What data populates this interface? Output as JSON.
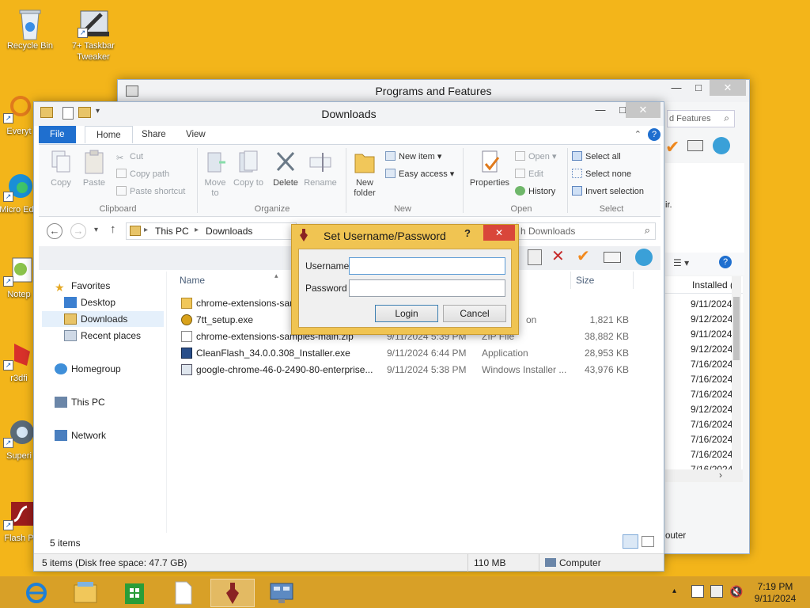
{
  "desktop": {
    "icons": [
      {
        "label": "Recycle Bin"
      },
      {
        "label": "7+ Taskbar Tweaker"
      },
      {
        "label": "Everyt"
      },
      {
        "label": "Micro Edg"
      },
      {
        "label": "Notep"
      },
      {
        "label": "r3dfi"
      },
      {
        "label": "Superi"
      },
      {
        "label": "Flash P"
      }
    ]
  },
  "programs_window": {
    "title": "Programs and Features",
    "search_placeholder": "d Features",
    "column_installed": "Installed (",
    "side_text": "ir.",
    "dates": [
      "9/11/2024",
      "9/12/2024",
      "9/11/2024",
      "9/12/2024",
      "7/16/2024",
      "7/16/2024",
      "7/16/2024",
      "9/12/2024",
      "7/16/2024",
      "7/16/2024",
      "7/16/2024",
      "7/16/2024"
    ],
    "status_text": "outer"
  },
  "explorer": {
    "title": "Downloads",
    "tabs": {
      "file": "File",
      "home": "Home",
      "share": "Share",
      "view": "View"
    },
    "ribbon": {
      "copy": "Copy",
      "paste": "Paste",
      "cut": "Cut",
      "copy_path": "Copy path",
      "paste_shortcut": "Paste shortcut",
      "clipboard": "Clipboard",
      "move_to": "Move to",
      "copy_to": "Copy to",
      "delete": "Delete",
      "rename": "Rename",
      "organize": "Organize",
      "new_folder": "New folder",
      "new_item": "New item",
      "easy_access": "Easy access",
      "new": "New",
      "properties": "Properties",
      "open": "Open",
      "edit": "Edit",
      "history": "History",
      "open_group": "Open",
      "select_all": "Select all",
      "select_none": "Select none",
      "invert_selection": "Invert selection",
      "select": "Select"
    },
    "address": {
      "root": "This PC",
      "folder": "Downloads"
    },
    "search_placeholder": "h Downloads",
    "nav": {
      "favorites": "Favorites",
      "desktop": "Desktop",
      "downloads": "Downloads",
      "recent": "Recent places",
      "homegroup": "Homegroup",
      "this_pc": "This PC",
      "network": "Network"
    },
    "columns": {
      "name": "Name",
      "size": "Size"
    },
    "files": [
      {
        "name": "chrome-extensions-sar",
        "date": "",
        "type": "",
        "size": ""
      },
      {
        "name": "7tt_setup.exe",
        "date": "",
        "type": "on",
        "size": "1,821 KB"
      },
      {
        "name": "chrome-extensions-samples-main.zip",
        "date": "9/11/2024 5:39 PM",
        "type": "ZIP File",
        "size": "38,882 KB"
      },
      {
        "name": "CleanFlash_34.0.0.308_Installer.exe",
        "date": "9/11/2024 6:44 PM",
        "type": "Application",
        "size": "28,953 KB"
      },
      {
        "name": "google-chrome-46-0-2490-80-enterprise...",
        "date": "9/11/2024 5:38 PM",
        "type": "Windows Installer ...",
        "size": "43,976 KB"
      }
    ],
    "item_count": "5 items",
    "status": {
      "items": "5 items (Disk free space: 47.7 GB)",
      "size": "110 MB",
      "location": "Computer"
    }
  },
  "dialog": {
    "title": "Set Username/Password",
    "help": "?",
    "username_label": "Username",
    "password_label": "Password",
    "username_value": "",
    "password_value": "",
    "login": "Login",
    "cancel": "Cancel"
  },
  "taskbar": {
    "time": "7:19 PM",
    "date": "9/11/2024"
  },
  "colors": {
    "desktop": "#f3b51a",
    "accent": "#1f6fcf",
    "dialog_frame": "#f0c452",
    "close_red": "#d9463a"
  }
}
